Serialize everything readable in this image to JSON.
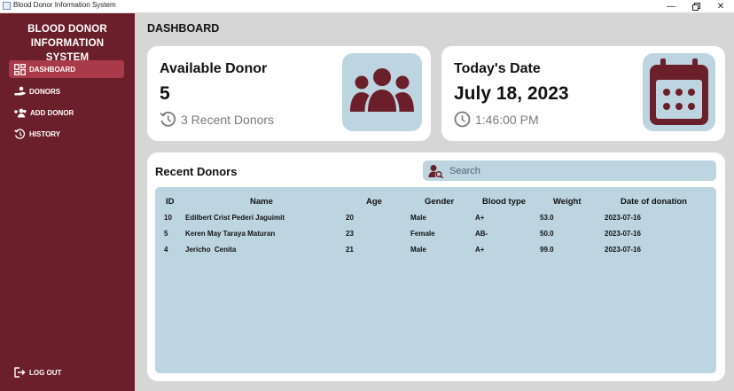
{
  "window": {
    "title": "Blood Donor Information System"
  },
  "sidebar": {
    "brand": "BLOOD DONOR INFORMATION SYSTEM",
    "items": [
      {
        "label": "DASHBOARD",
        "icon": "dashboard-icon",
        "active": true
      },
      {
        "label": "DONORS",
        "icon": "donors-icon"
      },
      {
        "label": "ADD DONOR",
        "icon": "add-donor-icon"
      },
      {
        "label": "HISTORY",
        "icon": "history-icon"
      }
    ],
    "logout": "LOG OUT"
  },
  "header": {
    "title": "DASHBOARD"
  },
  "cards": {
    "donor": {
      "title": "Available Donor",
      "count": "5",
      "recent": "3 Recent Donors",
      "icon": "group-icon"
    },
    "date": {
      "title": "Today's Date",
      "date": "July 18, 2023",
      "time": "1:46:00 PM",
      "icon": "calendar-icon"
    }
  },
  "recent": {
    "title": "Recent Donors",
    "search_placeholder": "Search",
    "columns": [
      "ID",
      "Name",
      "Age",
      "Gender",
      "Blood type",
      "Weight",
      "Date of donation"
    ],
    "rows": [
      [
        "10",
        "Edilbert Crist Pederi Jaguimit",
        "20",
        "Male",
        "A+",
        "53.0",
        "2023-07-16"
      ],
      [
        "5",
        "Keren May Taraya Maturan",
        "23",
        "Female",
        "AB-",
        "50.0",
        "2023-07-16"
      ],
      [
        "4",
        "Jericho  Cenita",
        "21",
        "Male",
        "A+",
        "99.0",
        "2023-07-16"
      ]
    ]
  },
  "colors": {
    "sidebar": "#6b1f2a",
    "active": "#a83a49",
    "icon_tile": "#bcd5e0",
    "icon_fill": "#6b1f2a",
    "background": "#d6d6d6"
  }
}
